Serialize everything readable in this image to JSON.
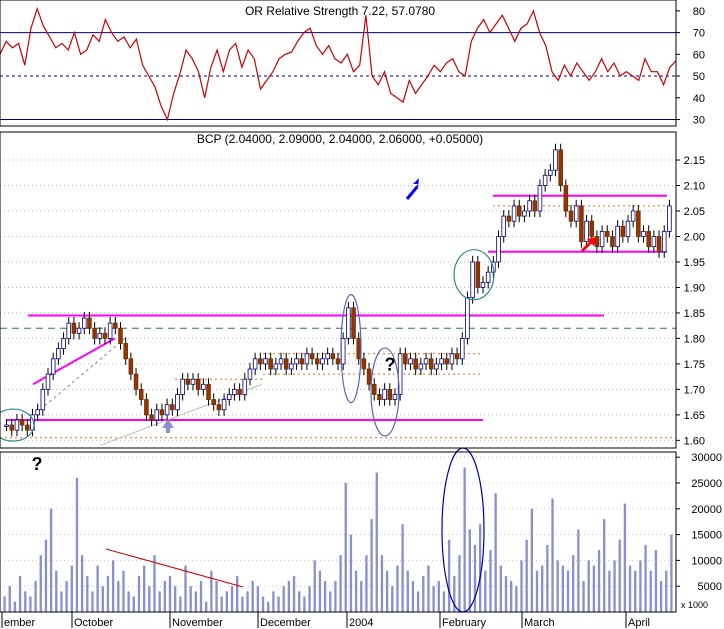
{
  "chart_data": [
    {
      "type": "line",
      "panel": "rsi",
      "title": "OR Relative Strength 7.22, 57.0780",
      "y_ticks": [
        30,
        40,
        50,
        60,
        70,
        80
      ],
      "ylim": [
        27,
        85
      ],
      "reference_lines": [
        30,
        50,
        70
      ],
      "series": [
        {
          "color": "#cc0000",
          "values": [
            60,
            66,
            63,
            65,
            55,
            72,
            81,
            73,
            68,
            63,
            65,
            62,
            70,
            60,
            62,
            69,
            66,
            76,
            70,
            66,
            68,
            63,
            67,
            55,
            50,
            45,
            36,
            30,
            42,
            51,
            62,
            58,
            52,
            40,
            54,
            62,
            52,
            62,
            65,
            54,
            62,
            58,
            44,
            48,
            52,
            58,
            60,
            61,
            66,
            70,
            72,
            64,
            60,
            64,
            58,
            56,
            60,
            52,
            55,
            78,
            50,
            46,
            52,
            42,
            40,
            38,
            48,
            42,
            46,
            50,
            55,
            52,
            56,
            58,
            52,
            50,
            66,
            72,
            76,
            70,
            74,
            78,
            72,
            66,
            72,
            74,
            80,
            70,
            64,
            52,
            48,
            55,
            50,
            56,
            52,
            48,
            52,
            58,
            52,
            56,
            50,
            52,
            50,
            48,
            58,
            52,
            52,
            46,
            54,
            57
          ]
        }
      ]
    },
    {
      "type": "candlestick",
      "panel": "price",
      "title": "BCP (2.04000, 2.09000, 2.04000, 2.06000, +0.05000)",
      "y_ticks": [
        "1.60",
        "1.65",
        "1.70",
        "1.75",
        "1.80",
        "1.85",
        "1.90",
        "1.95",
        "2.00",
        "2.05",
        "2.10",
        "2.15"
      ],
      "ylim": [
        1.585,
        2.205
      ],
      "closes": [
        1.63,
        1.62,
        1.64,
        1.63,
        1.62,
        1.65,
        1.66,
        1.7,
        1.73,
        1.76,
        1.78,
        1.8,
        1.83,
        1.81,
        1.82,
        1.84,
        1.82,
        1.8,
        1.81,
        1.8,
        1.83,
        1.82,
        1.79,
        1.76,
        1.73,
        1.7,
        1.68,
        1.65,
        1.64,
        1.66,
        1.65,
        1.67,
        1.66,
        1.69,
        1.72,
        1.71,
        1.72,
        1.7,
        1.71,
        1.68,
        1.67,
        1.66,
        1.68,
        1.69,
        1.7,
        1.69,
        1.72,
        1.74,
        1.76,
        1.75,
        1.76,
        1.74,
        1.75,
        1.76,
        1.74,
        1.75,
        1.76,
        1.75,
        1.77,
        1.76,
        1.75,
        1.76,
        1.77,
        1.76,
        1.75,
        1.8,
        1.86,
        1.8,
        1.76,
        1.74,
        1.71,
        1.69,
        1.68,
        1.7,
        1.68,
        1.69,
        1.77,
        1.75,
        1.76,
        1.74,
        1.75,
        1.76,
        1.74,
        1.75,
        1.76,
        1.75,
        1.77,
        1.76,
        1.8,
        1.88,
        1.95,
        1.9,
        1.91,
        1.93,
        1.95,
        2.0,
        2.04,
        2.03,
        2.06,
        2.04,
        2.05,
        2.07,
        2.05,
        2.1,
        2.12,
        2.13,
        2.17,
        2.1,
        2.05,
        2.03,
        2.06,
        1.99,
        2.03,
        2.0,
        1.98,
        2.01,
        2.0,
        1.98,
        2.02,
        2.0,
        2.03,
        2.05,
        2.0,
        2.01,
        1.98,
        2.0,
        1.97,
        2.01,
        2.06
      ],
      "series": [
        {
          "color": "#000000"
        }
      ]
    },
    {
      "type": "bar",
      "panel": "volume",
      "y_ticks": [
        5000,
        10000,
        15000,
        20000,
        25000,
        30000
      ],
      "ylim": [
        0,
        31000
      ],
      "scale_label": "x 1000",
      "series": [
        {
          "color": "#8a8fd0",
          "values": [
            3000,
            5000,
            2000,
            7000,
            4000,
            3000,
            6000,
            11000,
            14000,
            20000,
            8000,
            4000,
            6000,
            9000,
            26000,
            11000,
            7000,
            4000,
            9000,
            5000,
            7000,
            10000,
            6000,
            8000,
            4000,
            3000,
            7000,
            9000,
            5000,
            11000,
            4000,
            6000,
            7000,
            5000,
            3000,
            9000,
            5000,
            4000,
            6000,
            2000,
            8000,
            6000,
            3000,
            4000,
            5000,
            7000,
            3000,
            4000,
            6000,
            5000,
            3000,
            2000,
            4000,
            3000,
            5000,
            6000,
            7000,
            4000,
            3000,
            5000,
            10000,
            8000,
            6000,
            4000,
            6000,
            11000,
            25000,
            15000,
            8000,
            6000,
            11000,
            18000,
            27000,
            11000,
            8000,
            5000,
            9000,
            17000,
            8000,
            6000,
            4000,
            7000,
            9000,
            5000,
            6000,
            4000,
            14000,
            7000,
            11000,
            28000,
            16000,
            13000,
            17000,
            8000,
            12000,
            23000,
            9000,
            7000,
            6000,
            5000,
            10000,
            14000,
            20000,
            8000,
            9000,
            13000,
            22000,
            10000,
            9000,
            8000,
            11000,
            16000,
            6000,
            10000,
            9000,
            12000,
            18000,
            8000,
            10000,
            14000,
            21000,
            9000,
            8000,
            10000,
            13000,
            8000,
            12000,
            6000,
            8000,
            15000
          ]
        }
      ]
    }
  ],
  "x_axis": {
    "months": [
      "ember",
      "October",
      "November",
      "December",
      "2004",
      "February",
      "March",
      "April"
    ]
  },
  "annotations": {
    "question_orange": "?",
    "question_blue": "?"
  },
  "colors": {
    "rsi_line": "#cc0000",
    "reference_line": "#000080",
    "support_resistance": "#ff00ff",
    "candle_up": "#ffffff",
    "candle_down": "#993300",
    "volume_bar": "#8a8fd0",
    "ellipse_blue": "#5a64b4",
    "ellipse_teal": "#2e8b8b",
    "arrow_blue": "#0000ff",
    "arrow_red": "#ff0000",
    "arrow_up_purple": "#8a8fd0",
    "dashed_teal": "#2e6e6e",
    "dotted_orange": "#e07020"
  }
}
